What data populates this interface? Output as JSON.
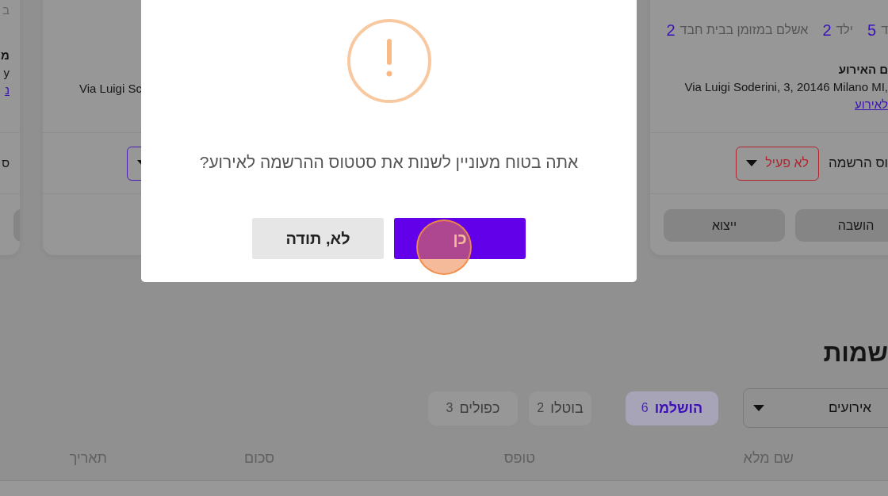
{
  "left_card": {
    "top_text": "ב",
    "title": "מ",
    "address": "y",
    "link": "נ",
    "status_label": "ס"
  },
  "middle_card": {
    "address": "Via Luigi Sc",
    "status_active": true
  },
  "right_card": {
    "counts": [
      {
        "label": "ד",
        "value": "5"
      },
      {
        "label": "ילד",
        "value": "2"
      },
      {
        "label": "אשלם במזומן בבית חבד",
        "value": "2"
      }
    ],
    "title": "ם האירוע",
    "address": "Via Luigi Soderini, 3, 20146 Milano MI,",
    "link": "לאירוע",
    "status_label": "וס הרשמה",
    "status_value": "לא פעיל",
    "status_active": false,
    "buttons": [
      "הושבה",
      "ייצוא"
    ]
  },
  "registrations": {
    "title": "שמות",
    "event_filter": "אירועים",
    "tabs": [
      {
        "label": "הושלמו",
        "count": "6",
        "selected": true
      },
      {
        "label": "בוטלו",
        "count": "2",
        "selected": false
      },
      {
        "label": "כפולים",
        "count": "3",
        "selected": false
      }
    ],
    "columns": [
      "שם מלא",
      "טופס",
      "סכום",
      "תאריך"
    ]
  },
  "dialog": {
    "message": "אתה בטוח מעוניין לשנות את סטטוס ההרשמה לאירוע?",
    "buttons": [
      {
        "label": "כן",
        "kind": "confirm"
      },
      {
        "label": "לא, תודה",
        "kind": "cancel"
      }
    ]
  }
}
